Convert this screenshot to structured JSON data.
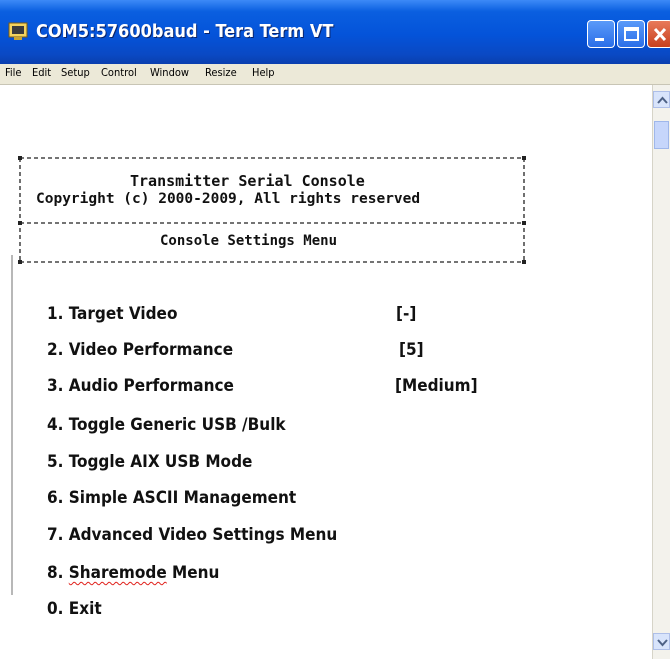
{
  "window": {
    "title": "COM5:57600baud - Tera Term VT",
    "icons": [
      "tera-term-app-icon",
      "minimize-icon",
      "maximize-icon",
      "close-icon"
    ],
    "colors": {
      "titlebar": "#0453d9",
      "close_button": "#c8401e",
      "menubar": "#ece9d8"
    }
  },
  "menubar": {
    "items": [
      "File",
      "Edit",
      "Setup",
      "Control",
      "Window",
      "Resize",
      "Help"
    ]
  },
  "console": {
    "header_line1": "Transmitter Serial Console",
    "header_line2": "Copyright (c) 2000-2009, All rights reserved",
    "menu_title": "Console Settings Menu",
    "options": [
      {
        "label": "1. Target Video",
        "value": "[-]"
      },
      {
        "label": "2. Video Performance",
        "value": "[5]"
      },
      {
        "label": "3. Audio Performance",
        "value": "[Medium]"
      },
      {
        "label": "4. Toggle Generic USB /Bulk"
      },
      {
        "label": "5. Toggle AIX USB Mode"
      },
      {
        "label": "6. Simple ASCII Management"
      },
      {
        "label": "7. Advanced Video Settings Menu"
      },
      {
        "prefix": "8. ",
        "word": "Sharemode",
        "suffix": " Menu"
      },
      {
        "label": "0. Exit"
      }
    ]
  }
}
